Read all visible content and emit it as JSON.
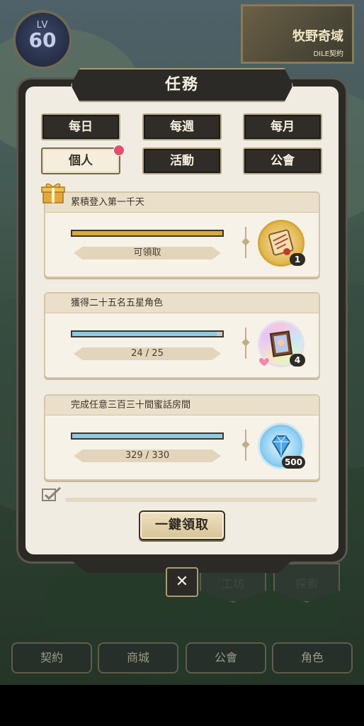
{
  "player": {
    "level_label": "LV",
    "level": "60"
  },
  "banner": {
    "title": "牧野奇域",
    "subtitle": "DILE契約"
  },
  "side_buttons": {
    "workshop": "工坊",
    "explore": "探索"
  },
  "bottom_nav": [
    {
      "label": "契約"
    },
    {
      "label": "商城"
    },
    {
      "label": "公會"
    },
    {
      "label": "角色"
    }
  ],
  "modal": {
    "title": "任務",
    "tabs": [
      {
        "label": "每日",
        "active": false
      },
      {
        "label": "每週",
        "active": false
      },
      {
        "label": "每月",
        "active": false
      },
      {
        "label": "個人",
        "active": true,
        "has_notification": true
      },
      {
        "label": "活動",
        "active": false
      },
      {
        "label": "公會",
        "active": false
      }
    ],
    "quests": [
      {
        "name": "累積登入第一千天",
        "status_text": "可領取",
        "progress": 1.0,
        "bar_color": "#d9ab3f",
        "reward_icon": "scroll-icon",
        "reward_qty": "1",
        "claimable": true
      },
      {
        "name": "獲得二十五名五星角色",
        "status_text": "24 / 25",
        "progress": 0.96,
        "bar_color": "#8dcbe0",
        "reward_icon": "portrait-frame-icon",
        "reward_qty": "4",
        "claimable": false
      },
      {
        "name": "完成任意三百三十間蜜話房間",
        "status_text": "329 / 330",
        "progress": 0.997,
        "bar_color": "#8dcbe0",
        "reward_icon": "diamond-icon",
        "reward_qty": "500",
        "claimable": false
      }
    ],
    "claim_all_label": "一鍵領取",
    "close_label": "✕"
  }
}
